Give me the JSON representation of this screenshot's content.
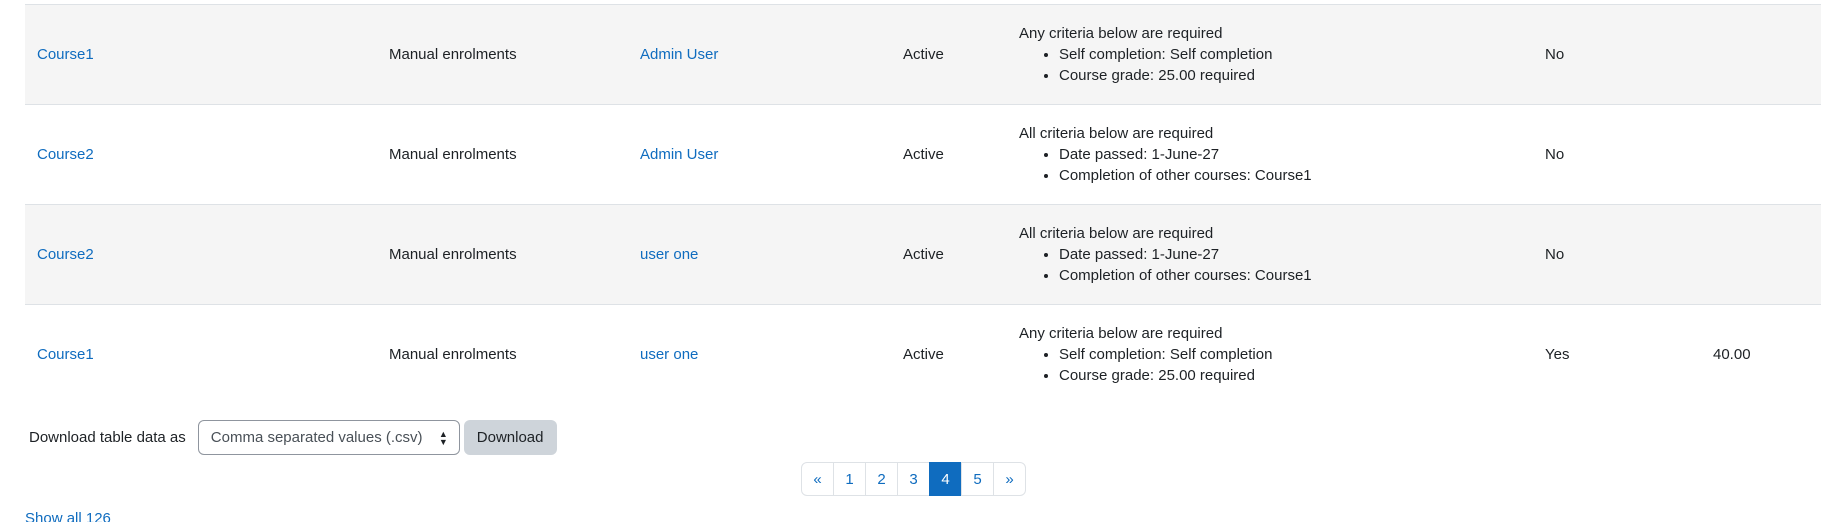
{
  "rows": [
    {
      "course": "Course1",
      "enrolment": "Manual enrolments",
      "user": "Admin User",
      "status": "Active",
      "criteria_head": "Any criteria below are required",
      "criteria": [
        "Self completion: Self completion",
        "Course grade: 25.00 required"
      ],
      "complete": "No",
      "grade": ""
    },
    {
      "course": "Course2",
      "enrolment": "Manual enrolments",
      "user": "Admin User",
      "status": "Active",
      "criteria_head": "All criteria below are required",
      "criteria": [
        "Date passed: 1-June-27",
        "Completion of other courses: Course1"
      ],
      "complete": "No",
      "grade": ""
    },
    {
      "course": "Course2",
      "enrolment": "Manual enrolments",
      "user": "user one",
      "status": "Active",
      "criteria_head": "All criteria below are required",
      "criteria": [
        "Date passed: 1-June-27",
        "Completion of other courses: Course1"
      ],
      "complete": "No",
      "grade": ""
    },
    {
      "course": "Course1",
      "enrolment": "Manual enrolments",
      "user": "user one",
      "status": "Active",
      "criteria_head": "Any criteria below are required",
      "criteria": [
        "Self completion: Self completion",
        "Course grade: 25.00 required"
      ],
      "complete": "Yes",
      "grade": "40.00"
    }
  ],
  "download": {
    "label": "Download table data as",
    "format_selected": "Comma separated values (.csv)",
    "button": "Download"
  },
  "pagination": {
    "prev": "«",
    "pages": [
      "1",
      "2",
      "3",
      "4",
      "5"
    ],
    "current": "4",
    "next": "»"
  },
  "show_all": "Show all 126",
  "colors": {
    "link": "#0f6cbf",
    "row_stripe": "#f5f5f5",
    "active_page": "#0f6cbf",
    "button_bg": "#ced4da"
  }
}
